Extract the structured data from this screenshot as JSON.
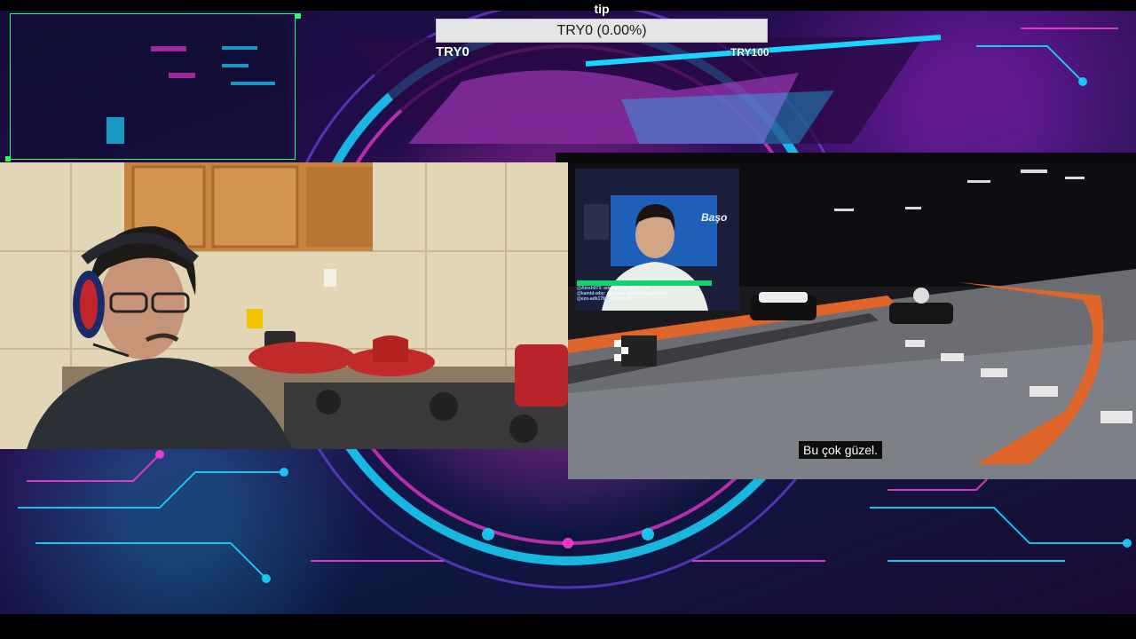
{
  "tip_goal": {
    "label": "tip",
    "progress_text": "TRY0 (0.00%)",
    "progress_fraction": 0.0,
    "min_label": "TRY0",
    "max_label": "TRY100",
    "fill_color": "#4aa3ff"
  },
  "video": {
    "subtitle": "Bu çok güzel.",
    "inset_chat": {
      "lines": [
        {
          "user": "@Atesh073:",
          "text": "adam emekli yorgo çıktı"
        },
        {
          "user": "@kamid-wby:",
          "text": "abi kurgu yoo böyle şeymi olur"
        },
        {
          "user": "@ezo-adk1786:",
          "text": "olamaz abi"
        }
      ]
    },
    "inset_sign": "Başo"
  },
  "colors": {
    "frame_accent": "#2cff5a",
    "neon_cyan": "#19d4ff",
    "neon_magenta": "#ff3bd6"
  }
}
